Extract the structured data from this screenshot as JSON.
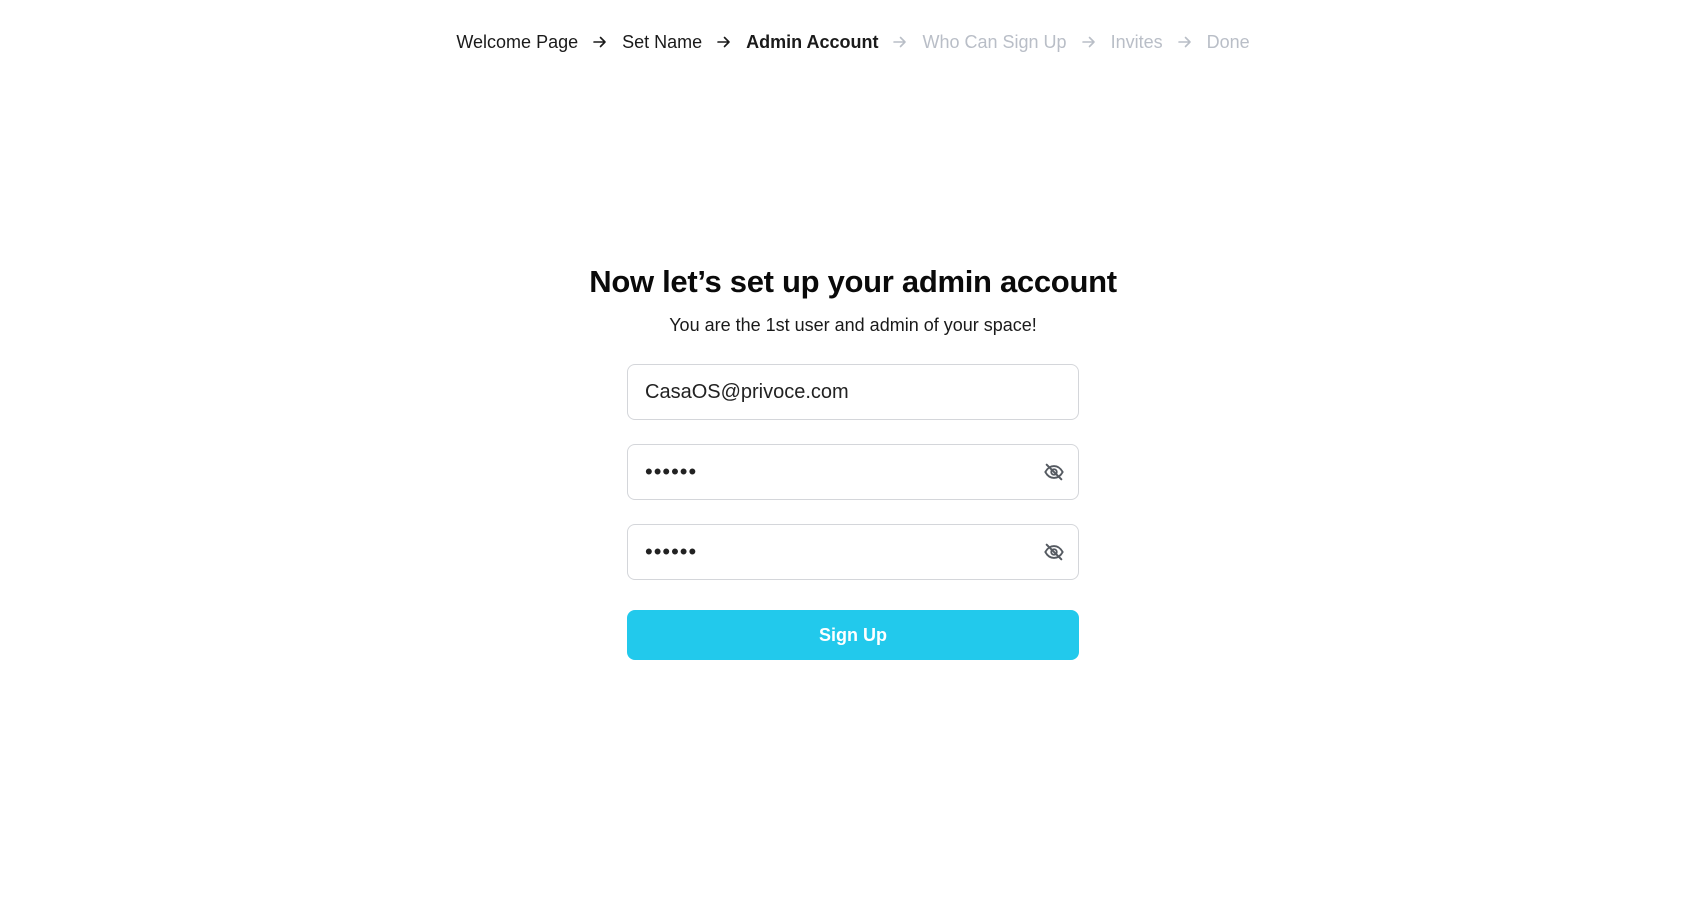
{
  "breadcrumb": {
    "steps": [
      {
        "label": "Welcome Page",
        "state": "done"
      },
      {
        "label": "Set Name",
        "state": "done"
      },
      {
        "label": "Admin Account",
        "state": "current"
      },
      {
        "label": "Who Can Sign Up",
        "state": "upcoming"
      },
      {
        "label": "Invites",
        "state": "upcoming"
      },
      {
        "label": "Done",
        "state": "upcoming"
      }
    ],
    "separator_icon": "arrow-right-icon"
  },
  "main": {
    "title": "Now let’s set up your admin account",
    "subtitle": "You are the 1st user and admin of your space!"
  },
  "form": {
    "email_value": "CasaOS@privoce.com",
    "password_value": "••••••",
    "confirm_password_value": "••••••",
    "visibility_icon": "eye-off-icon",
    "signup_label": "Sign Up"
  },
  "colors": {
    "accent": "#22c9ec",
    "upcoming_text": "#b9bec7",
    "border": "#d4d6da"
  }
}
